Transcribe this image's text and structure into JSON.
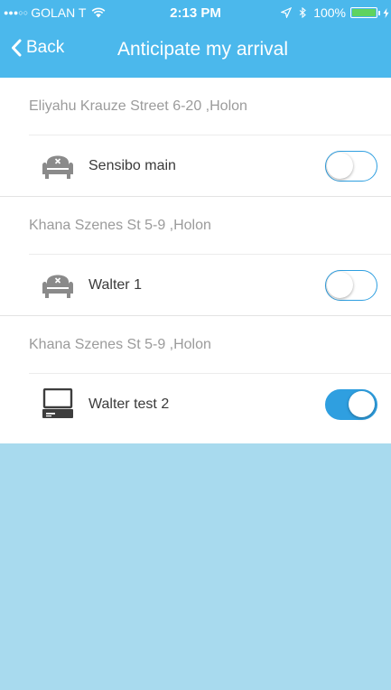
{
  "status_bar": {
    "signal": "●●●○○",
    "carrier": "GOLAN T",
    "time": "2:13 PM",
    "battery": "100%"
  },
  "nav": {
    "back_label": "Back",
    "title": "Anticipate my arrival"
  },
  "groups": [
    {
      "address": "Eliyahu Krauze Street 6-20 ,Holon",
      "device": {
        "name": "Sensibo main",
        "icon": "armchair-icon",
        "enabled": false
      }
    },
    {
      "address": "Khana Szenes St 5-9 ,Holon",
      "device": {
        "name": "Walter 1",
        "icon": "armchair-icon",
        "enabled": false
      }
    },
    {
      "address": "Khana Szenes St 5-9 ,Holon",
      "device": {
        "name": "Walter test 2",
        "icon": "computer-icon",
        "enabled": true
      }
    }
  ],
  "colors": {
    "header": "#4bb8ec",
    "toggle_accent": "#2f9fe0",
    "empty_area": "#a8daee"
  }
}
